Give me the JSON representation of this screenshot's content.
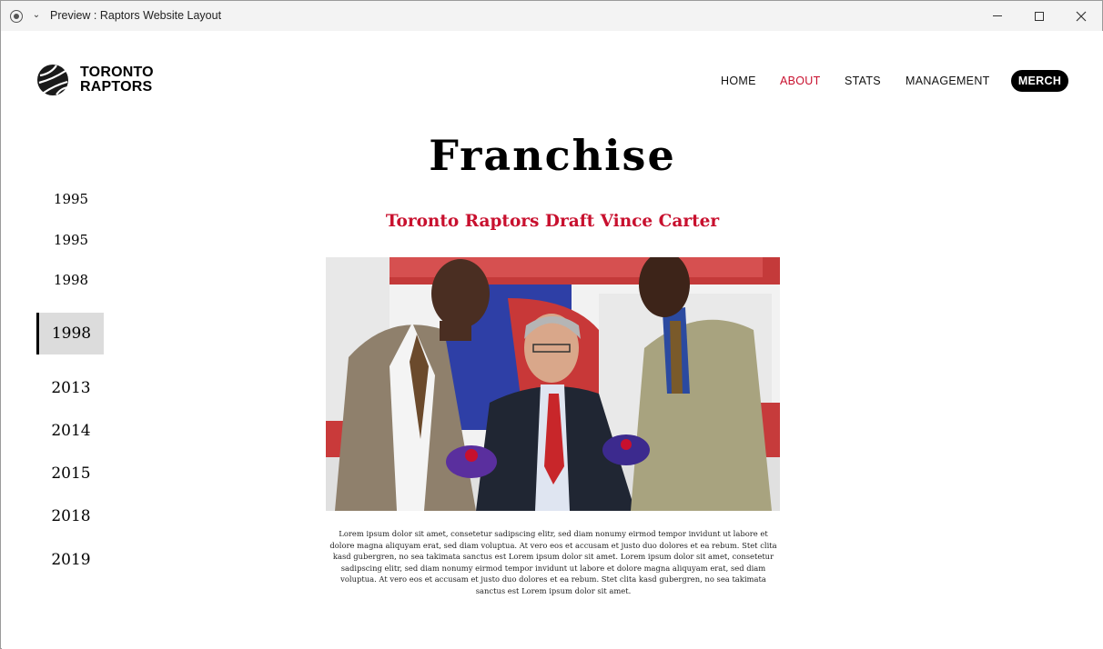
{
  "window": {
    "title": "Preview : Raptors Website Layout"
  },
  "header": {
    "logo_line1": "TORONTO",
    "logo_line2": "RAPTORS",
    "nav": {
      "home": "HOME",
      "about": "ABOUT",
      "stats": "STATS",
      "management": "MANAGEMENT",
      "merch": "MERCH"
    },
    "active_nav": "about"
  },
  "main": {
    "title": "Franchise",
    "subtitle": "Toronto Raptors Draft Vince Carter",
    "photo": {
      "icon": "draft-photo-image"
    },
    "body": "Lorem ipsum dolor sit amet, consetetur sadipscing elitr, sed diam nonumy eirmod tempor invidunt ut labore et dolore magna aliquyam erat, sed diam voluptua. At vero eos et accusam et justo duo dolores et ea rebum. Stet clita kasd gubergren, no sea takimata sanctus est Lorem ipsum dolor sit amet. Lorem ipsum dolor sit amet, consetetur sadipscing elitr, sed diam nonumy eirmod tempor invidunt ut labore et dolore magna aliquyam erat, sed diam voluptua. At vero eos et accusam et justo duo dolores et ea rebum. Stet clita kasd gubergren, no sea takimata sanctus est Lorem ipsum dolor sit amet."
  },
  "timeline": {
    "years": [
      "1995",
      "1995",
      "1998",
      "1998",
      "2013",
      "2014",
      "2015",
      "2018",
      "2019"
    ],
    "active_index": 3
  },
  "colors": {
    "accent": "#c8102e",
    "merch_bg": "#000000",
    "active_year_bg": "#dcdcdc"
  }
}
